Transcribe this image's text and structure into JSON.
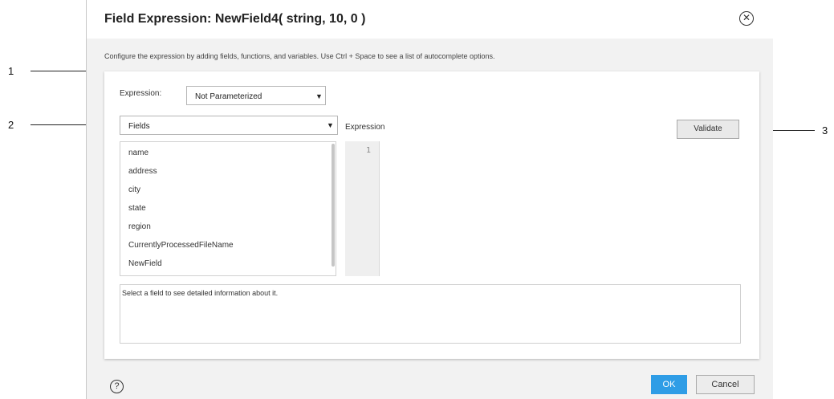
{
  "dialog": {
    "title": "Field Expression: NewField4( string, 10, 0 )",
    "close_icon": "close-circle-icon",
    "instructions": "Configure the expression by adding fields, functions, and variables. Use Ctrl + Space to see a list of autocomplete options."
  },
  "expression": {
    "label": "Expression:",
    "parameter_select": "Not Parameterized",
    "source_select": "Fields",
    "heading": "Expression",
    "validate_label": "Validate"
  },
  "fields": [
    {
      "name": "name"
    },
    {
      "name": "address"
    },
    {
      "name": "city"
    },
    {
      "name": "state"
    },
    {
      "name": "region"
    },
    {
      "name": "CurrentlyProcessedFileName"
    },
    {
      "name": "NewField"
    }
  ],
  "editor": {
    "line_number": "1"
  },
  "info_text": "Select a field to see detailed information about it.",
  "footer": {
    "help_icon": "help-icon",
    "ok_label": "OK",
    "cancel_label": "Cancel"
  },
  "callouts": [
    {
      "label": "1"
    },
    {
      "label": "2"
    },
    {
      "label": "3"
    }
  ],
  "colors": {
    "accent": "#2f9de6",
    "panel_bg": "#f2f2f2"
  }
}
